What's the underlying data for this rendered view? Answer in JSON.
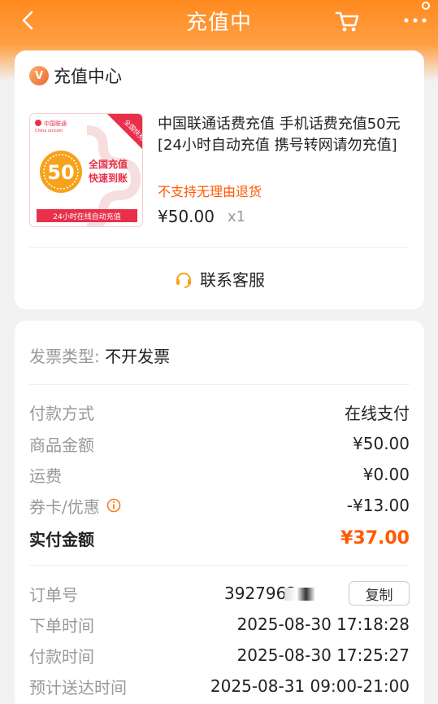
{
  "header": {
    "title": "充值中"
  },
  "shop": {
    "logo_text": "V",
    "name": "充值中心"
  },
  "product": {
    "thumb": {
      "brand": "中国联通",
      "brand_en": "China unicom",
      "ribbon": "全国快充",
      "amount": "50",
      "line1": "全国充值",
      "line2": "快速到账",
      "footer": "24小时在线自动充值"
    },
    "title": "中国联通话费充值 手机话费充值50元 [24小时自动充值 携号转网请勿充值]",
    "notice": "不支持无理由退货",
    "price": "¥50.00",
    "qty": "x1"
  },
  "customer_service": {
    "label": "联系客服"
  },
  "invoice": {
    "label": "发票类型:",
    "value": "不开发票"
  },
  "payment": {
    "method_label": "付款方式",
    "method_value": "在线支付",
    "goods_label": "商品金额",
    "goods_value": "¥50.00",
    "shipping_label": "运费",
    "shipping_value": "¥0.00",
    "coupon_label": "券卡/优惠",
    "coupon_value": "-¥13.00",
    "paid_label": "实付金额",
    "paid_value": "¥37.00"
  },
  "order": {
    "no_label": "订单号",
    "no_value": "3927962",
    "copy_label": "复制",
    "created_label": "下单时间",
    "created_value": "2025-08-30 17:18:28",
    "paid_label": "付款时间",
    "paid_value": "2025-08-30 17:25:27",
    "eta_label": "预计送达时间",
    "eta_value": "2025-08-31 09:00-21:00"
  },
  "colors": {
    "accent": "#ff8a1e",
    "price_highlight": "#ff5a00"
  }
}
